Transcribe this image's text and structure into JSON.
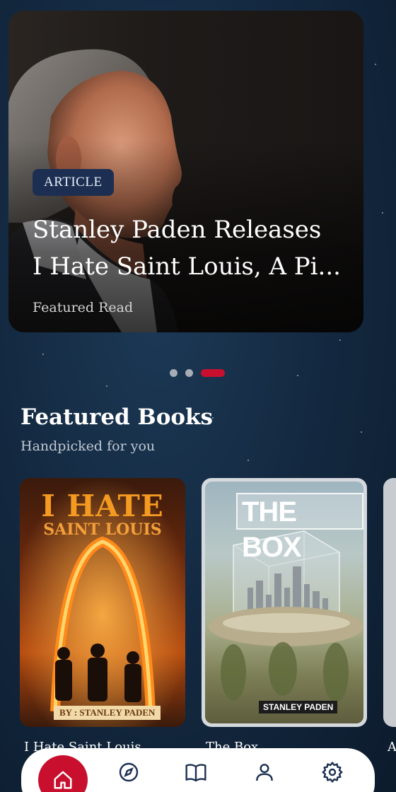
{
  "hero": {
    "badge": "ARTICLE",
    "title_line1": "Stanley Paden Releases",
    "title_line2": "I Hate Saint Louis, A Pi...",
    "subtitle": "Featured Read"
  },
  "carousel": {
    "count": 3,
    "active_index": 2
  },
  "section": {
    "title": "Featured Books",
    "subtitle": "Handpicked for you"
  },
  "books": [
    {
      "label": "I Hate Saint Louis",
      "cover_title_line1": "I HATE",
      "cover_title_line2": "SAINT LOUIS",
      "cover_author": "BY : STANLEY PADEN"
    },
    {
      "label": "The Box",
      "cover_title_line1": "THE BOX",
      "cover_author": "STANLEY PADEN"
    },
    {
      "label": "A"
    }
  ],
  "nav": {
    "items": [
      {
        "icon": "home-icon",
        "active": true
      },
      {
        "icon": "compass-icon",
        "active": false
      },
      {
        "icon": "book-open-icon",
        "active": false
      },
      {
        "icon": "user-icon",
        "active": false
      },
      {
        "icon": "gear-icon",
        "active": false
      }
    ]
  },
  "colors": {
    "accent": "#c8102e",
    "badge_bg": "#1c2f52",
    "background": "#142a42"
  }
}
